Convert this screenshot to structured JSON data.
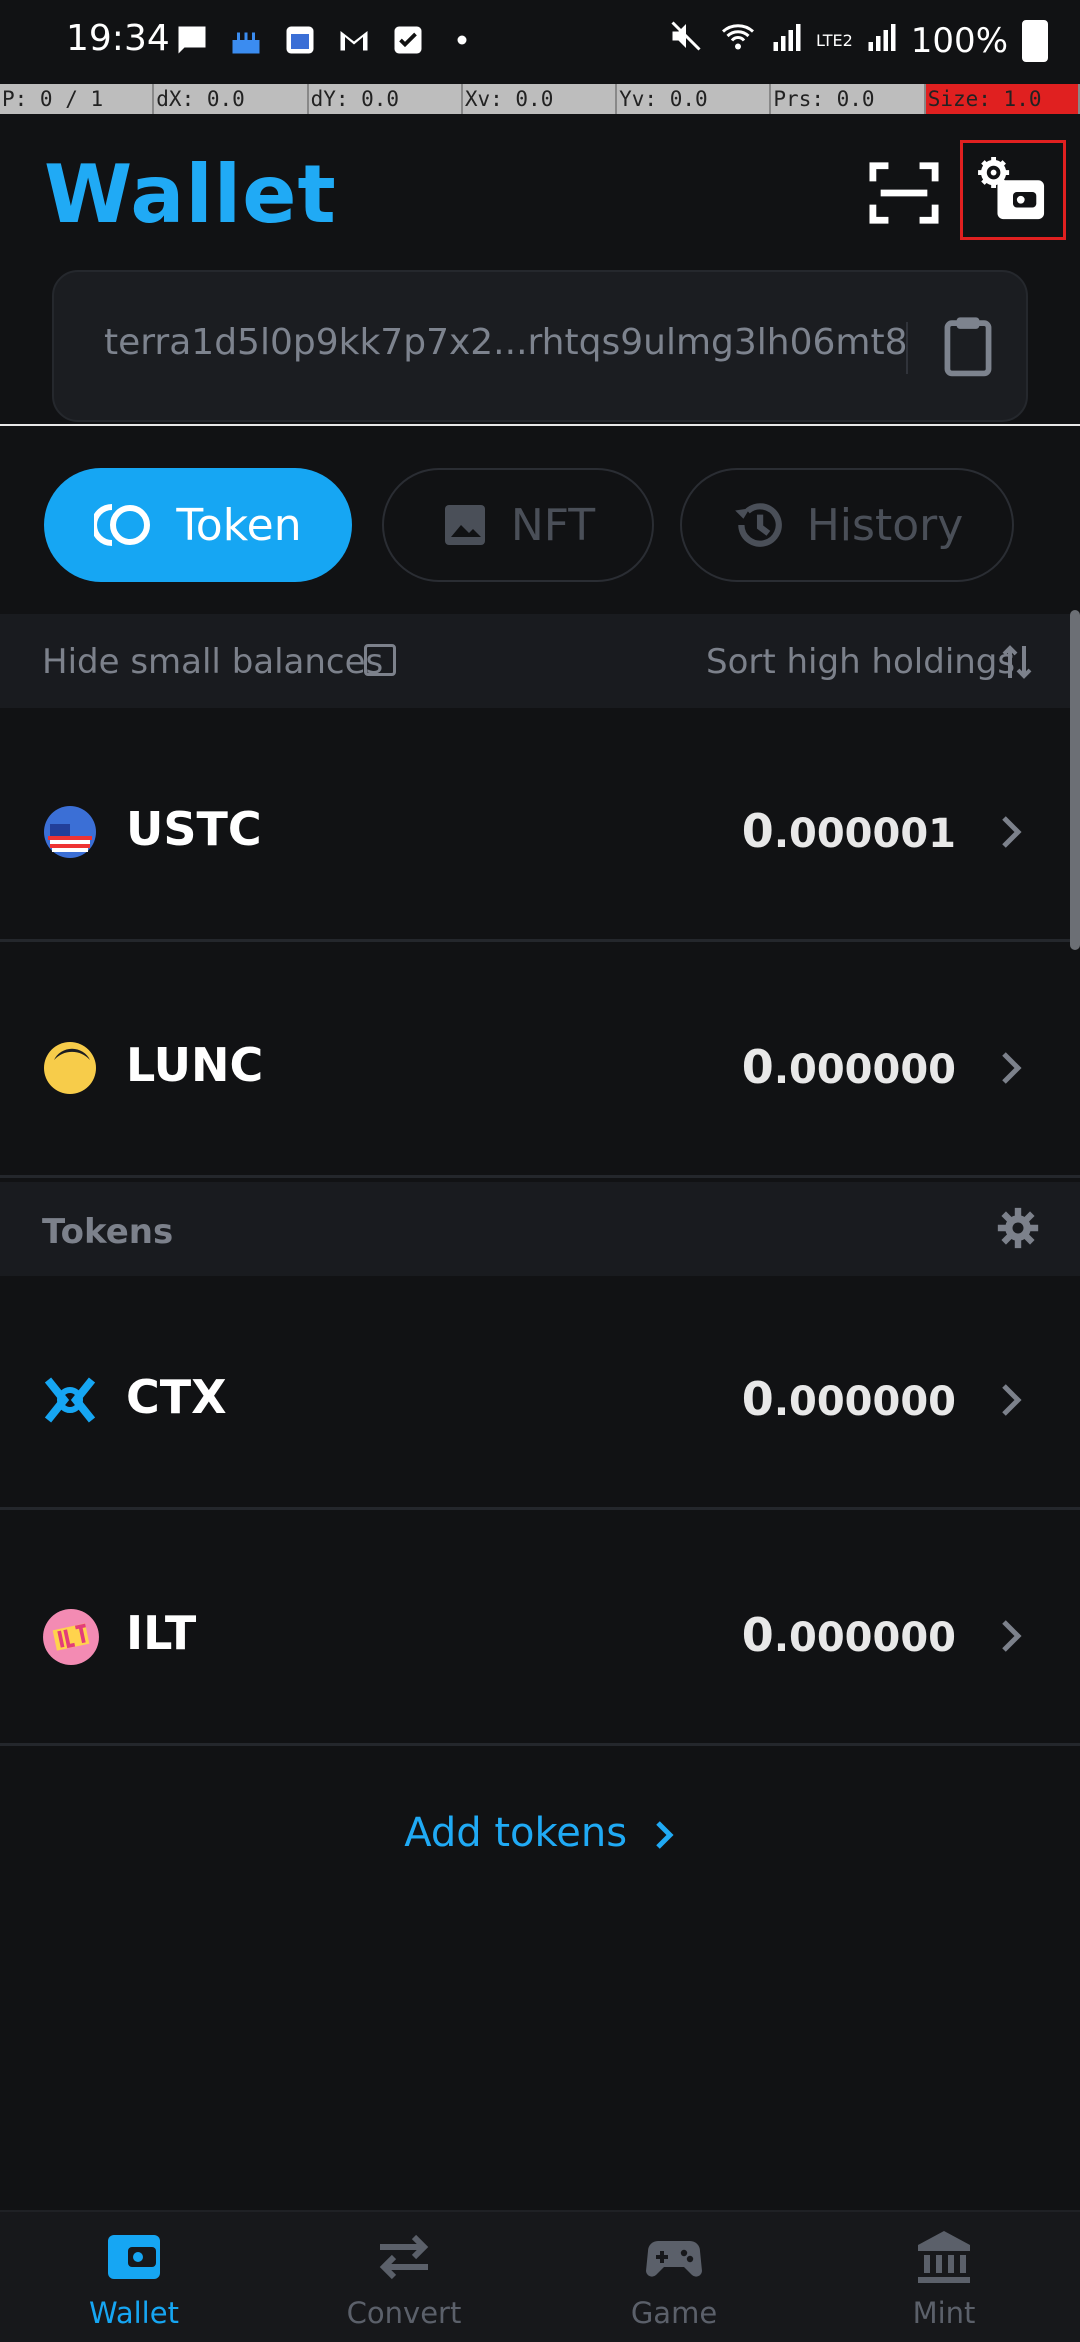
{
  "status_bar": {
    "time": "19:34",
    "battery": "100%",
    "network": "LTE2"
  },
  "debug_bar": [
    "P: 0 / 1",
    "dX: 0.0",
    "dY: 0.0",
    "Xv: 0.0",
    "Yv: 0.0",
    "Prs: 0.0",
    "Size: 1.0"
  ],
  "header": {
    "title": "Wallet",
    "scan_icon": "scan-icon",
    "settings_icon": "wallet-settings-icon"
  },
  "address": {
    "value": "terra1d5l0p9kk7p7x2...rhtqs9ulmg3lh06mt8",
    "copy_icon": "clipboard-icon"
  },
  "tabs": [
    {
      "label": "Token",
      "icon": "token-icon",
      "active": true
    },
    {
      "label": "NFT",
      "icon": "image-icon",
      "active": false
    },
    {
      "label": "History",
      "icon": "history-icon",
      "active": false
    }
  ],
  "filter": {
    "hide_label": "Hide small balances",
    "sort_label": "Sort high holdings"
  },
  "native_tokens": [
    {
      "symbol": "USTC",
      "balance_int": "0",
      "balance_dec": ".000001",
      "icon": "ustc-logo"
    },
    {
      "symbol": "LUNC",
      "balance_int": "0",
      "balance_dec": ".000000",
      "icon": "lunc-logo"
    }
  ],
  "tokens_section": {
    "title": "Tokens",
    "icon": "gear-icon"
  },
  "custom_tokens": [
    {
      "symbol": "CTX",
      "balance_int": "0",
      "balance_dec": ".000000",
      "icon": "ctx-logo"
    },
    {
      "symbol": "ILT",
      "balance_int": "0",
      "balance_dec": ".000000",
      "icon": "ilt-logo"
    }
  ],
  "add_tokens": "Add tokens",
  "bottom_nav": [
    {
      "label": "Wallet",
      "icon": "wallet-icon",
      "active": true
    },
    {
      "label": "Convert",
      "icon": "swap-icon",
      "active": false
    },
    {
      "label": "Game",
      "icon": "gamepad-icon",
      "active": false
    },
    {
      "label": "Mint",
      "icon": "bank-icon",
      "active": false
    }
  ],
  "colors": {
    "accent": "#16a6f3",
    "background": "#111214",
    "muted": "#7c818b"
  }
}
